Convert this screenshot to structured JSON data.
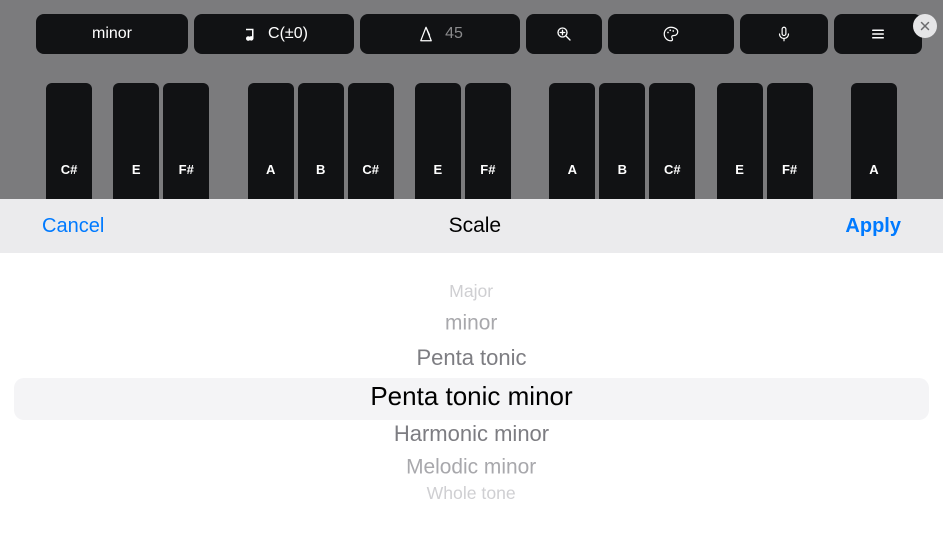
{
  "toolbar": {
    "scale_label": "minor",
    "key_label": "C(±0)",
    "tempo_value": "45"
  },
  "keys": [
    "C#",
    null,
    "E",
    "F#",
    null,
    null,
    "A",
    "B",
    "C#",
    null,
    "E",
    "F#",
    null,
    null,
    "A",
    "B",
    "C#",
    null,
    "E",
    "F#",
    null,
    null,
    "A"
  ],
  "sheet": {
    "cancel": "Cancel",
    "title": "Scale",
    "apply": "Apply"
  },
  "picker": {
    "options": [
      "Major",
      "minor",
      "Penta tonic",
      "Penta tonic minor",
      "Harmonic minor",
      "Melodic minor",
      "Whole tone"
    ],
    "selected_index": 3
  }
}
